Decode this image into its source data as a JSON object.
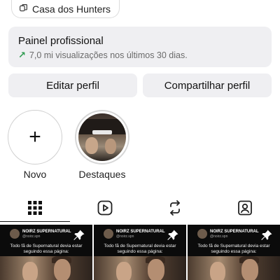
{
  "chip": {
    "label": "Casa dos Hunters",
    "icon": "threads-icon"
  },
  "panel": {
    "title": "Painel profissional",
    "subtitle": "7,0 mi visualizações nos últimos 30 dias.",
    "trend_icon": "trend-up-arrow-icon",
    "trend_color": "#2e9b4f"
  },
  "buttons": {
    "edit": "Editar perfil",
    "share": "Compartilhar perfil"
  },
  "highlights": [
    {
      "label": "Novo",
      "icon": "plus-icon"
    },
    {
      "label": "Destaques"
    }
  ],
  "tabs": [
    {
      "name": "grid",
      "icon": "grid-icon",
      "active": true
    },
    {
      "name": "reels",
      "icon": "reels-play-icon",
      "active": false
    },
    {
      "name": "reposts",
      "icon": "repost-icon",
      "active": false
    },
    {
      "name": "tagged",
      "icon": "tagged-person-icon",
      "active": false
    }
  ],
  "posts": [
    {
      "account": "NOIRZ SUPERNATURAL",
      "handle": "@noirz.spn",
      "caption": "Todo fã de Supernatural devia estar seguindo essa página:",
      "pinned": true
    },
    {
      "account": "NOIRZ SUPERNATURAL",
      "handle": "@noirz.spn",
      "caption": "Todo fã de Supernatural devia estar seguindo essa página:",
      "pinned": true
    },
    {
      "account": "NOIRZ SUPERNATURAL",
      "handle": "@noirz.spn",
      "caption": "Todo fã de Supernatural devia estar seguindo essa página:",
      "pinned": true
    }
  ]
}
